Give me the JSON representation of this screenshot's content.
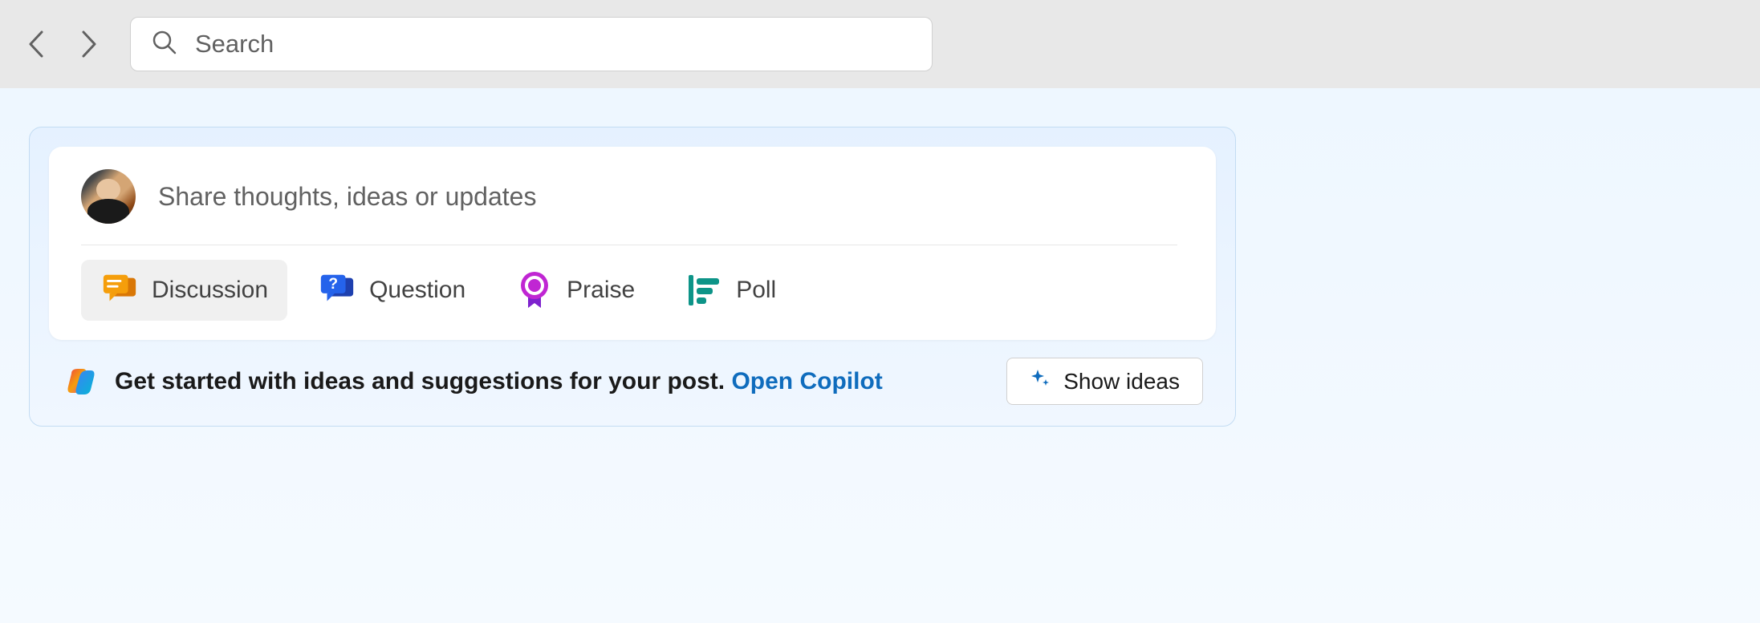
{
  "search": {
    "placeholder": "Search"
  },
  "composer": {
    "prompt_placeholder": "Share thoughts, ideas or updates",
    "types": {
      "discussion": "Discussion",
      "question": "Question",
      "praise": "Praise",
      "poll": "Poll"
    }
  },
  "copilot": {
    "message": "Get started with ideas and suggestions for your post.",
    "link": "Open Copilot",
    "button": "Show ideas"
  }
}
